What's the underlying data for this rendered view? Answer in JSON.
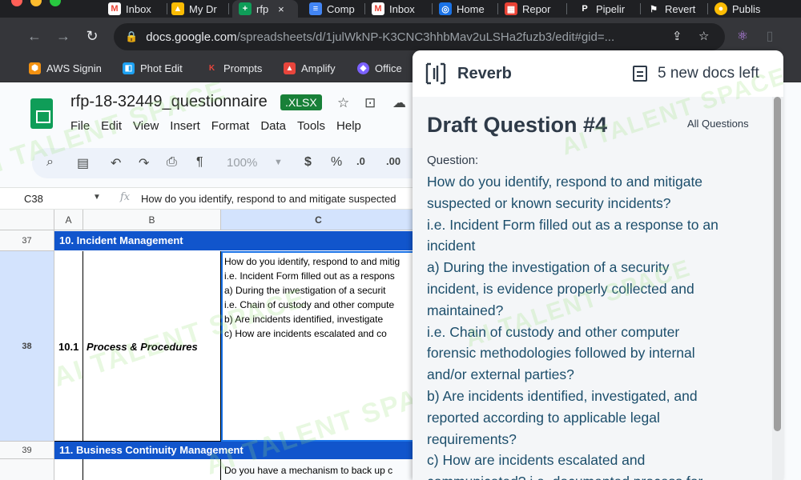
{
  "browser": {
    "tabs": [
      {
        "label": "Inbox",
        "icon": "gmail-icon"
      },
      {
        "label": "My Dr",
        "icon": "drive-icon"
      },
      {
        "label": "rfp",
        "icon": "sheets-icon",
        "active": true
      },
      {
        "label": "Comp",
        "icon": "docs-icon"
      },
      {
        "label": "Inbox",
        "icon": "gmail-icon"
      },
      {
        "label": "Home",
        "icon": "home-app-icon"
      },
      {
        "label": "Repor",
        "icon": "report-icon"
      },
      {
        "label": "Pipelir",
        "icon": "pipeline-icon"
      },
      {
        "label": "Revert",
        "icon": "reverb-icon"
      },
      {
        "label": "Publis",
        "icon": "chrome-icon"
      }
    ],
    "close_glyph": "×",
    "url_host": "docs.google.com",
    "url_path": "/spreadsheets/d/1julWkNP-K3CNC3hhbMav2uLSHa2fuzb3/edit#gid=...",
    "bookmarks": [
      {
        "label": "AWS Signin",
        "color": "#f29111"
      },
      {
        "label": "Phot Edit",
        "color": "#1da1f2"
      },
      {
        "label": "Prompts",
        "color": "#e8453c"
      },
      {
        "label": "Amplify",
        "color": "#e8453c"
      },
      {
        "label": "Office",
        "color": "#7b61ff"
      }
    ]
  },
  "sheets": {
    "title": "rfp-18-32449_questionnaire",
    "badge": ".XLSX",
    "menus": [
      "File",
      "Edit",
      "View",
      "Insert",
      "Format",
      "Data",
      "Tools",
      "Help"
    ],
    "zoom": "100%",
    "currency": "$",
    "percent": "%",
    "dec_less": ".0",
    "dec_more": ".00",
    "name_box": "C38",
    "fx": "fx",
    "formula": "How do you identify, respond to and mitigate suspected",
    "columns": [
      "A",
      "B",
      "C"
    ],
    "rows": [
      "37",
      "38",
      "39"
    ],
    "section_10": "10.  Incident Management",
    "section_11": "11.  Business Continuity Management",
    "item_number": "10.1",
    "item_label": "Process & Procedures",
    "cell_lines": [
      "How do you identify, respond to and mitig",
      "i.e. Incident Form filled out as a respons",
      "a)    During the investigation of a securit",
      "i.e. Chain of custody and other compute",
      "b)    Are incidents identified, investigate",
      "c)    How are incidents escalated and co"
    ],
    "row39_text": "Do you have a mechanism to back up c"
  },
  "reverb": {
    "brand": "Reverb",
    "docs_left": "5 new docs left",
    "draft_title": "Draft Question #4",
    "all_questions": "All Questions",
    "question_label": "Question:",
    "question_lines": [
      "How do you identify, respond to and mitigate",
      "suspected or known security incidents?",
      "i.e. Incident Form filled out as a response to an",
      "incident",
      "a)     During the investigation of a security",
      "incident, is evidence properly collected and",
      "maintained?",
      "i.e. Chain of custody and other computer",
      "forensic methodologies followed by internal",
      "and/or external parties?",
      "b) Are incidents identified, investigated, and",
      "reported according to applicable legal",
      "requirements?",
      "c)     How are incidents escalated and",
      "communicated? i.e. documented process for"
    ]
  },
  "watermark": "AI TALENT SPACE"
}
